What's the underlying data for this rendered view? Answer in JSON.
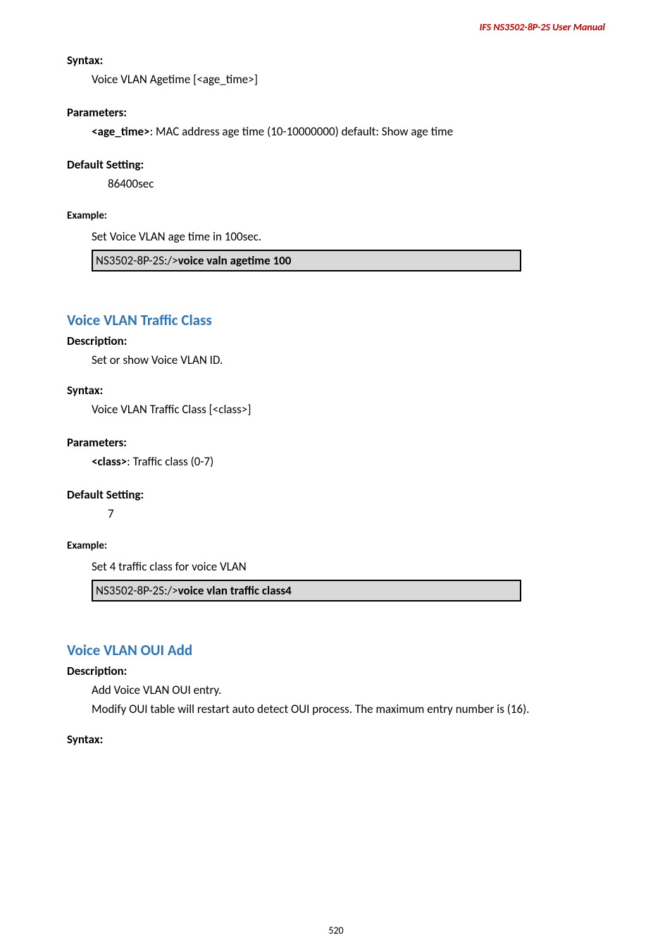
{
  "header": {
    "title": "IFS  NS3502-8P-2S  User  Manual"
  },
  "s1": {
    "syntax_label": "Syntax:",
    "syntax_text": "Voice VLAN Agetime [<age_time>]",
    "params_label": "Parameters:",
    "param_bold": "<age_time>",
    "param_rest": ": MAC address age time (10-10000000) default: Show age time",
    "default_label": "Default Setting:",
    "default_val": "86400sec",
    "example_label": "Example:",
    "example_text": "Set Voice VLAN age time in 100sec.",
    "code_prefix": "NS3502-8P-2S:/>",
    "code_bold": "voice valn agetime 100"
  },
  "s2": {
    "heading": "Voice VLAN Traffic Class",
    "desc_label": "Description:",
    "desc_text": "Set or show Voice VLAN ID.",
    "syntax_label": "Syntax:",
    "syntax_text": "Voice VLAN Traffic Class [<class>]",
    "params_label": "Parameters:",
    "param_bold": "<class>",
    "param_rest": ": Traffic class (0-7)",
    "default_label": "Default Setting:",
    "default_val": "7",
    "example_label": "Example:",
    "example_text": "Set 4 traffic class for voice VLAN",
    "code_prefix": "NS3502-8P-2S:/>",
    "code_bold": "voice vlan traffic class4"
  },
  "s3": {
    "heading": "Voice VLAN OUI Add",
    "desc_label": "Description:",
    "desc_text1": "Add Voice VLAN OUI entry.",
    "desc_text2": "Modify OUI table will restart auto detect OUI process. The maximum entry number is (16).",
    "syntax_label": "Syntax:"
  },
  "footer": {
    "page": "520"
  }
}
